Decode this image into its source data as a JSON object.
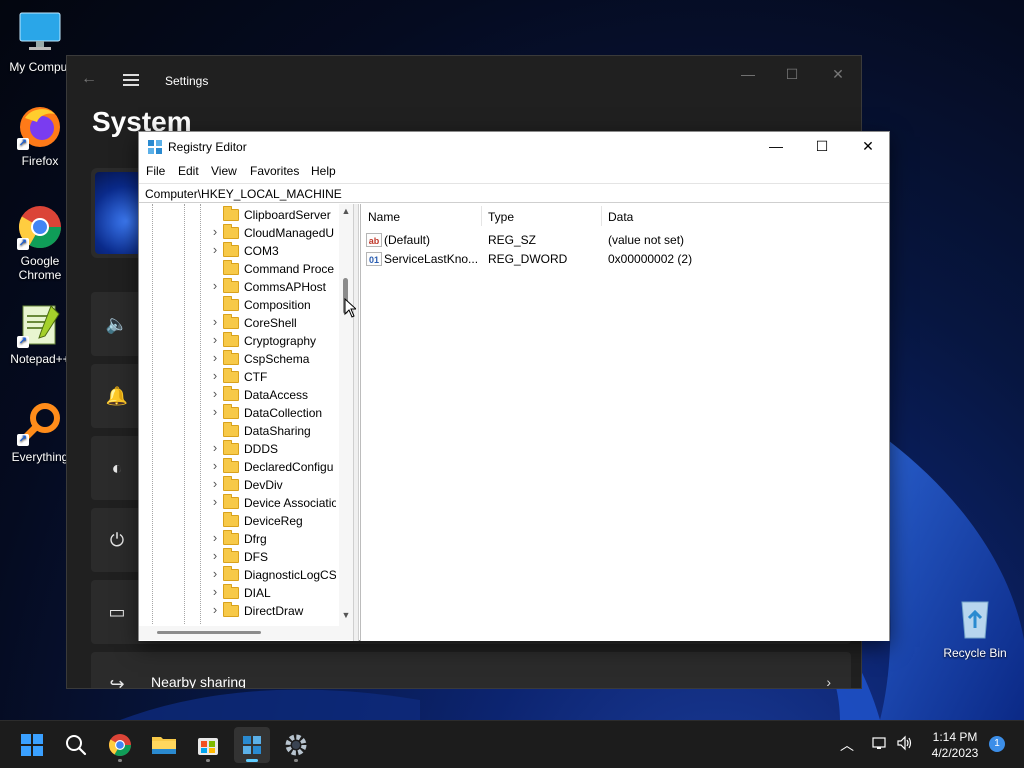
{
  "desktop": {
    "icons": [
      {
        "label": "My Comput",
        "icon": "monitor-icon"
      },
      {
        "label": "Firefox",
        "icon": "firefox-icon"
      },
      {
        "label": "Google Chrome",
        "icon": "chrome-icon"
      },
      {
        "label": "Notepad++",
        "icon": "notepadpp-icon"
      },
      {
        "label": "Everything",
        "icon": "everything-search-icon"
      },
      {
        "label": "Recycle Bin",
        "icon": "recycle-bin-icon"
      }
    ]
  },
  "settings": {
    "title": "Settings",
    "heading": "System",
    "rows": [
      {
        "icon": "speaker-icon",
        "label": ""
      },
      {
        "icon": "bell-icon",
        "label": ""
      },
      {
        "icon": "focus-icon",
        "label": ""
      },
      {
        "icon": "power-icon",
        "label": ""
      },
      {
        "icon": "battery-icon",
        "label": ""
      },
      {
        "icon": "share-icon",
        "label": "Nearby sharing"
      }
    ]
  },
  "regedit": {
    "title": "Registry Editor",
    "menu": [
      "File",
      "Edit",
      "View",
      "Favorites",
      "Help"
    ],
    "address": "Computer\\HKEY_LOCAL_MACHINE",
    "tree": [
      {
        "name": "ClipboardServer",
        "expandable": false
      },
      {
        "name": "CloudManagedU",
        "expandable": true
      },
      {
        "name": "COM3",
        "expandable": true
      },
      {
        "name": "Command Proce",
        "expandable": false
      },
      {
        "name": "CommsAPHost",
        "expandable": true
      },
      {
        "name": "Composition",
        "expandable": false
      },
      {
        "name": "CoreShell",
        "expandable": true
      },
      {
        "name": "Cryptography",
        "expandable": true
      },
      {
        "name": "CspSchema",
        "expandable": true
      },
      {
        "name": "CTF",
        "expandable": true
      },
      {
        "name": "DataAccess",
        "expandable": true
      },
      {
        "name": "DataCollection",
        "expandable": true
      },
      {
        "name": "DataSharing",
        "expandable": false
      },
      {
        "name": "DDDS",
        "expandable": true
      },
      {
        "name": "DeclaredConfigu",
        "expandable": true
      },
      {
        "name": "DevDiv",
        "expandable": true
      },
      {
        "name": "Device Associatio",
        "expandable": true
      },
      {
        "name": "DeviceReg",
        "expandable": false
      },
      {
        "name": "Dfrg",
        "expandable": true
      },
      {
        "name": "DFS",
        "expandable": true
      },
      {
        "name": "DiagnosticLogCS",
        "expandable": true
      },
      {
        "name": "DIAL",
        "expandable": true
      },
      {
        "name": "DirectDraw",
        "expandable": true
      }
    ],
    "columns": {
      "name": "Name",
      "type": "Type",
      "data": "Data"
    },
    "values": [
      {
        "icon": "ab",
        "name": "(Default)",
        "type": "REG_SZ",
        "data": "(value not set)"
      },
      {
        "icon": "01",
        "name": "ServiceLastKno...",
        "type": "REG_DWORD",
        "data": "0x00000002 (2)"
      }
    ]
  },
  "taskbar": {
    "apps": [
      "start-icon",
      "search-icon",
      "chrome-icon",
      "file-explorer-icon",
      "store-icon",
      "regedit-icon",
      "settings-icon"
    ],
    "time": "1:14 PM",
    "date": "4/2/2023",
    "notifications": "1"
  },
  "colors": {
    "accent": "#60cdff",
    "taskbar": "#1c1c1c",
    "settings_bg": "#202020",
    "folder": "#f7c948"
  }
}
